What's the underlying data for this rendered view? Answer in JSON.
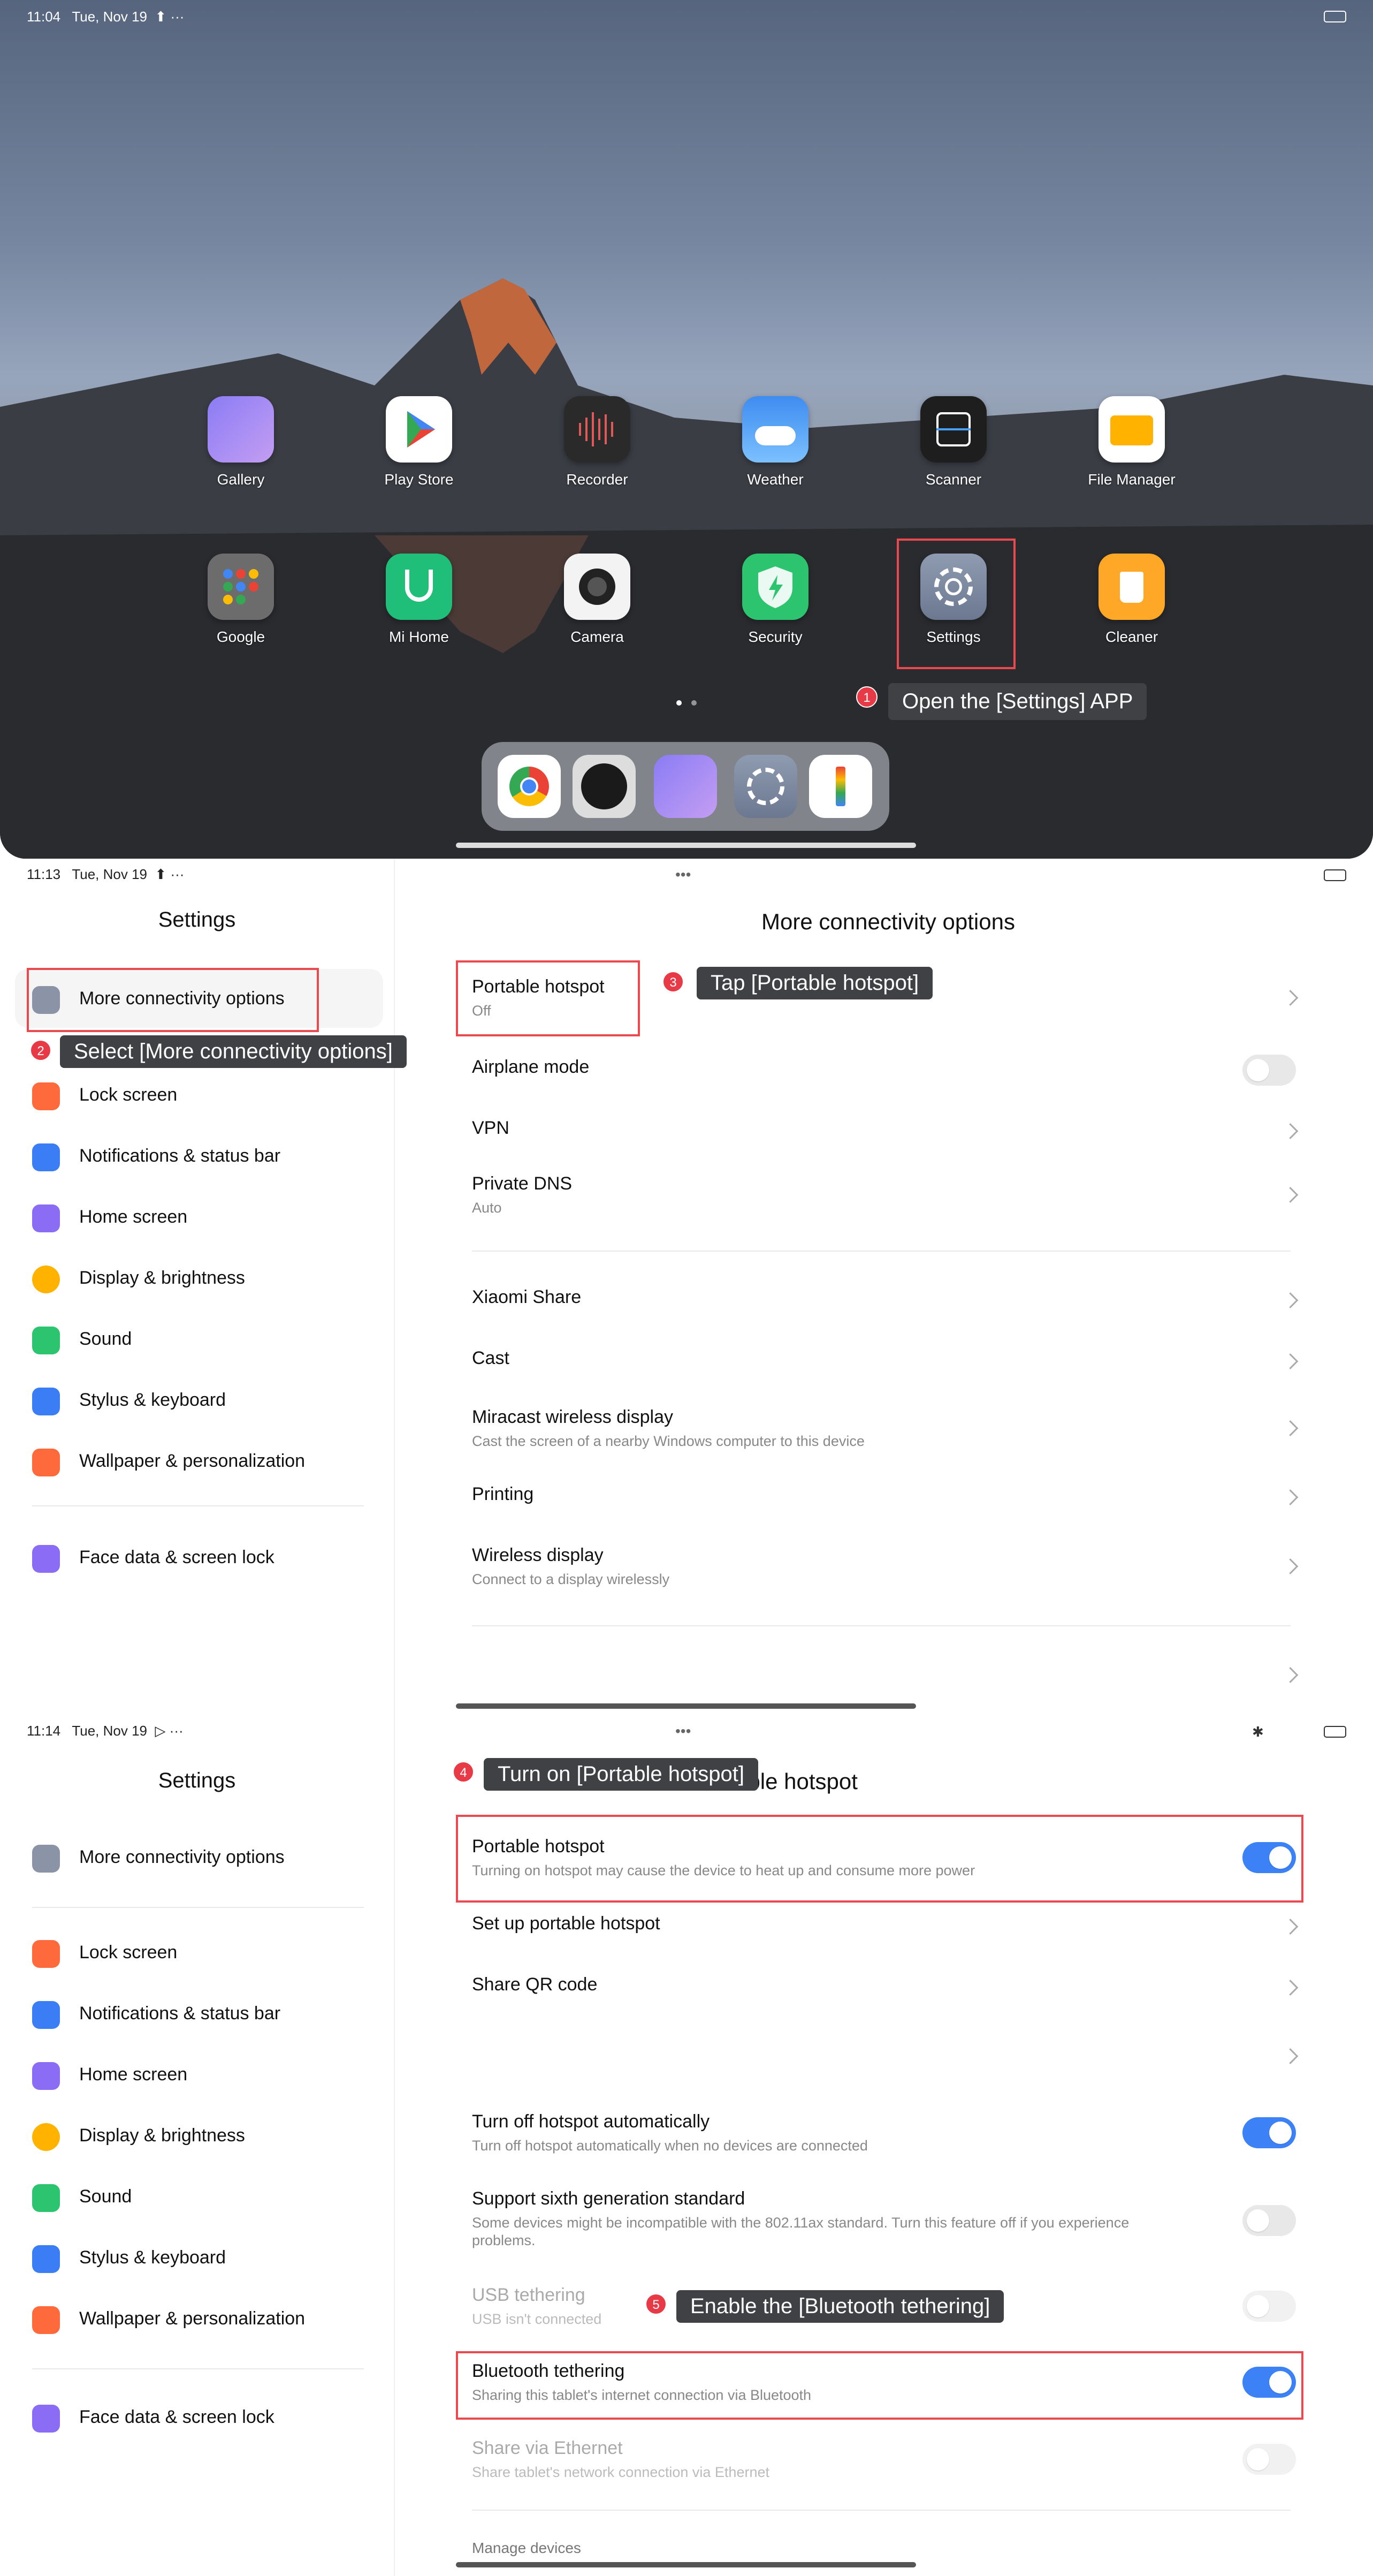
{
  "panel1": {
    "status_time": "11:04",
    "status_date": "Tue, Nov 19",
    "apps_row1": [
      "Gallery",
      "Play Store",
      "Recorder",
      "Weather",
      "Scanner",
      "File Manager"
    ],
    "apps_row2": [
      "Google",
      "Mi Home",
      "Camera",
      "Security",
      "Settings",
      "Cleaner"
    ],
    "step_number": "1",
    "step_tip": "Open the [Settings] APP"
  },
  "panel2": {
    "status_time": "11:13",
    "status_date": "Tue, Nov 19",
    "sidebar_title": "Settings",
    "sidebar_items": [
      "More connectivity options",
      "Lock screen",
      "Notifications & status bar",
      "Home screen",
      "Display & brightness",
      "Sound",
      "Stylus & keyboard",
      "Wallpaper & personalization",
      "Face data & screen lock"
    ],
    "main_title": "More connectivity options",
    "rows": [
      {
        "title": "Portable hotspot",
        "sub": "Off"
      },
      {
        "title": "Airplane mode",
        "sub": ""
      },
      {
        "title": "VPN",
        "sub": ""
      },
      {
        "title": "Private DNS",
        "sub": "Auto"
      },
      {
        "title": "Xiaomi Share",
        "sub": ""
      },
      {
        "title": "Cast",
        "sub": ""
      },
      {
        "title": "Miracast wireless display",
        "sub": "Cast the screen of a nearby Windows computer to this device"
      },
      {
        "title": "Printing",
        "sub": ""
      },
      {
        "title": "Wireless display",
        "sub": "Connect to a display wirelessly"
      }
    ],
    "step2_number": "2",
    "step2_tip": "Select [More connectivity options]",
    "step3_number": "3",
    "step3_tip": "Tap [Portable hotspot]"
  },
  "panel3": {
    "status_time": "11:14",
    "status_date": "Tue, Nov 19",
    "sidebar_title": "Settings",
    "sidebar_items": [
      "More connectivity options",
      "Lock screen",
      "Notifications & status bar",
      "Home screen",
      "Display & brightness",
      "Sound",
      "Stylus & keyboard",
      "Wallpaper & personalization",
      "Face data & screen lock"
    ],
    "main_title": "Portable hotspot",
    "rows": [
      {
        "title": "Portable hotspot",
        "sub": "Turning on  hotspot may cause the device to heat up and consume more power",
        "toggle": "on"
      },
      {
        "title": "Set up portable hotspot",
        "sub": ""
      },
      {
        "title": "Share QR code",
        "sub": ""
      },
      {
        "title": "Turn off hotspot automatically",
        "sub": "Turn off hotspot automatically when no devices are connected",
        "toggle": "on"
      },
      {
        "title": "Support sixth generation standard",
        "sub": "Some devices might be incompatible with the 802.11ax standard. Turn this feature off if you experience",
        "sub2": "problems.",
        "toggle": "off"
      },
      {
        "title": "USB tethering",
        "sub": "USB isn't connected",
        "toggle": "disabled"
      },
      {
        "title": "Bluetooth tethering",
        "sub": "Sharing this tablet's internet connection via Bluetooth",
        "toggle": "on"
      },
      {
        "title": "Share via Ethernet",
        "sub": "Share tablet's network connection via Ethernet",
        "toggle": "disabled"
      },
      {
        "title": "Manage devices",
        "sub": ""
      }
    ],
    "step4_number": "4",
    "step4_tip": "Turn on [Portable hotspot]",
    "step5_number": "5",
    "step5_tip": "Enable the [Bluetooth tethering]"
  }
}
